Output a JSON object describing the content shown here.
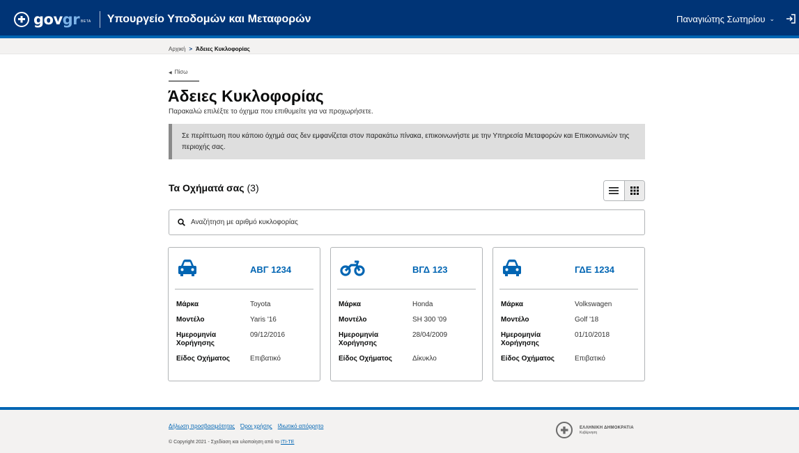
{
  "header": {
    "logo_text_a": "gov",
    "logo_text_b": "gr",
    "logo_badge": "BETA",
    "ministry": "Υπουργείο Υποδομών και Μεταφορών",
    "user_name": "Παναγιώτης Σωτηρίου",
    "icons": {
      "emblem": "greek-cross-emblem",
      "chevron": "chevron-down-icon",
      "logout": "logout-icon"
    }
  },
  "breadcrumb": {
    "home": "Αρχική",
    "separator": ">",
    "current": "Άδειες Κυκλοφορίας"
  },
  "back_link": "Πίσω",
  "page_title": "Άδειες Κυκλοφορίας",
  "subtitle": "Παρακαλώ επιλέξτε το όχημα που επιθυμείτε για να προχωρήσετε.",
  "notice": "Σε περίπτωση που κάποιο όχημά σας δεν εμφανίζεται στον παρακάτω πίνακα, επικοινωνήστε με την Υπηρεσία Μεταφορών και Επικοινωνιών της περιοχής σας.",
  "vehicles_section": {
    "title": "Τα Οχήματά σας",
    "count": "(3)",
    "view_modes": [
      "list-icon",
      "grid-icon"
    ],
    "active_view": "grid"
  },
  "search": {
    "placeholder": "Αναζήτηση με αριθμό κυκλοφορίας",
    "value": "",
    "icon": "search-icon"
  },
  "labels": {
    "brand": "Μάρκα",
    "model": "Μοντέλο",
    "date": "Ημερομηνία Χορήγησης",
    "type": "Είδος Οχήματος"
  },
  "vehicles": [
    {
      "icon": "car-icon",
      "plate": "ΑΒΓ 1234",
      "brand": "Toyota",
      "model": "Yaris '16",
      "date": "09/12/2016",
      "type": "Επιβατικό"
    },
    {
      "icon": "motorcycle-icon",
      "plate": "ΒΓΔ 123",
      "brand": "Honda",
      "model": "SH 300 '09",
      "date": "28/04/2009",
      "type": "Δίκυκλο"
    },
    {
      "icon": "car-icon",
      "plate": "ΓΔΕ 1234",
      "brand": "Volkswagen",
      "model": "Golf '18",
      "date": "01/10/2018",
      "type": "Επιβατικό"
    }
  ],
  "footer": {
    "links": [
      "Δήλωση προσβασιμότητας",
      "Όροι χρήσης",
      "Ιδιωτικό απόρρητο"
    ],
    "copyright_prefix": "© Copyright 2021 - Σχεδίαση και υλοποίηση από το",
    "copyright_link": "ΙΤΙ-ΤΕ",
    "gov_line1": "ΕΛΛΗΝΙΚΗ ΔΗΜΟΚΡΑΤΙΑ",
    "gov_line2": "Κυβέρνηση"
  },
  "colors": {
    "header_bg": "#003476",
    "accent": "#0065b3",
    "notice_bg": "#dedede"
  }
}
